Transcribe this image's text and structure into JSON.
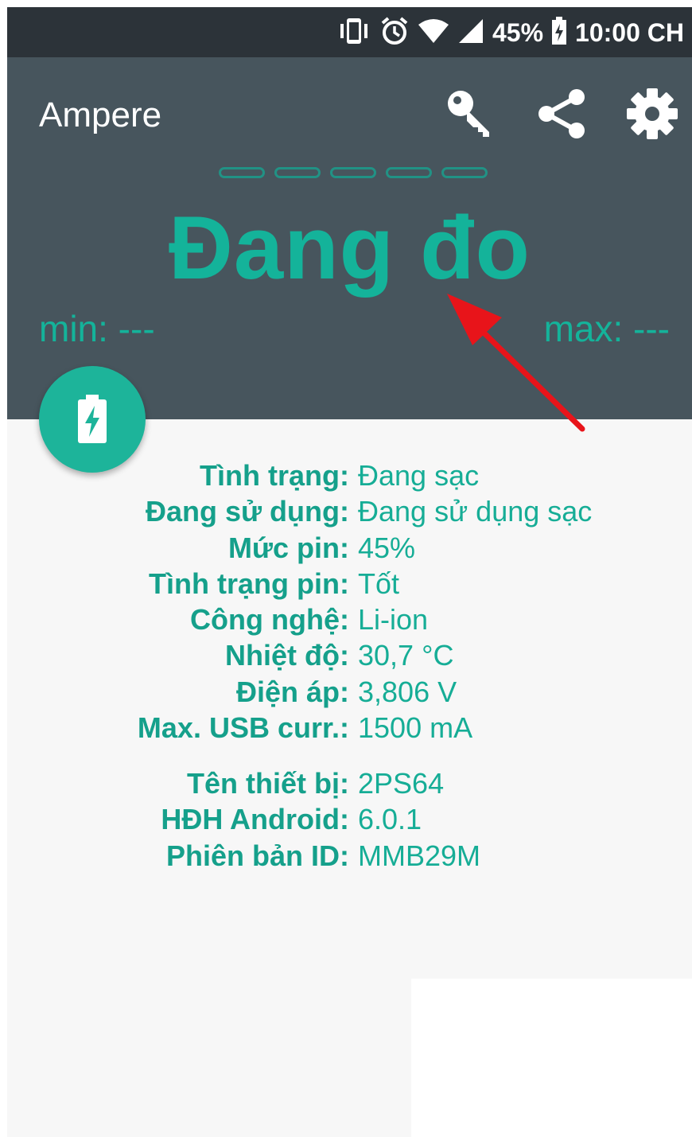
{
  "status_bar": {
    "battery_percent": "45%",
    "time": "10:00 CH",
    "icons": [
      "vibrate-icon",
      "alarm-icon",
      "wifi-icon",
      "signal-icon",
      "battery-charging-icon"
    ]
  },
  "app_bar": {
    "title": "Ampere",
    "actions": [
      "key-icon",
      "share-icon",
      "settings-gear-icon"
    ]
  },
  "measurement": {
    "status": "Đang đo",
    "min_label": "min: ---",
    "max_label": "max: ---"
  },
  "fab": {
    "icon": "battery-charging-icon"
  },
  "battery_info": [
    {
      "label": "Tình trạng:",
      "value": "Đang sạc"
    },
    {
      "label": "Đang sử dụng:",
      "value": "Đang sử dụng sạc"
    },
    {
      "label": "Mức pin:",
      "value": "45%"
    },
    {
      "label": "Tình trạng pin:",
      "value": "Tốt"
    },
    {
      "label": "Công nghệ:",
      "value": "Li-ion"
    },
    {
      "label": "Nhiệt độ:",
      "value": "30,7 °C"
    },
    {
      "label": "Điện áp:",
      "value": "3,806 V"
    },
    {
      "label": "Max. USB curr.:",
      "value": "1500 mA"
    }
  ],
  "device_info": [
    {
      "label": "Tên thiết bị:",
      "value": "2PS64"
    },
    {
      "label": "HĐH Android:",
      "value": "6.0.1"
    },
    {
      "label": "Phiên bản ID:",
      "value": "MMB29M"
    }
  ],
  "colors": {
    "accent": "#14b39a",
    "app_bar": "#47555d",
    "status_bar": "#2c3339",
    "annotation_arrow": "#e8141a"
  }
}
